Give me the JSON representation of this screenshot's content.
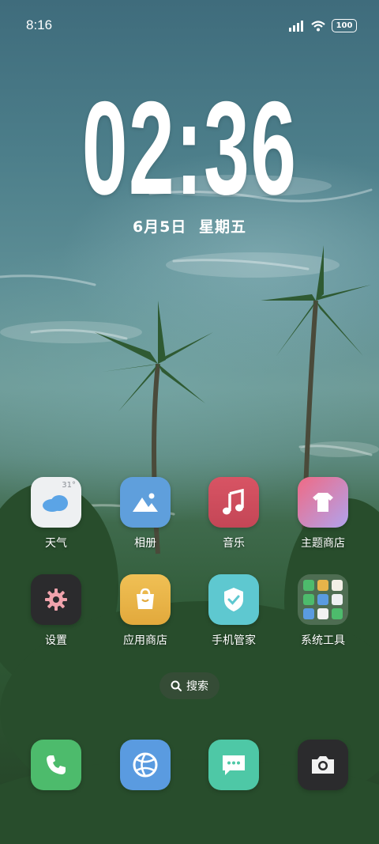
{
  "status_bar": {
    "time": "8:16",
    "battery": "100"
  },
  "lockclock": {
    "time": "02:36",
    "date_day": "6月5日",
    "date_weekday": "星期五"
  },
  "apps": [
    {
      "label": "天气",
      "icon": "weather-icon",
      "temp": "31°"
    },
    {
      "label": "相册",
      "icon": "gallery-icon"
    },
    {
      "label": "音乐",
      "icon": "music-icon"
    },
    {
      "label": "主题商店",
      "icon": "theme-store-icon"
    },
    {
      "label": "设置",
      "icon": "settings-icon"
    },
    {
      "label": "应用商店",
      "icon": "app-store-icon"
    },
    {
      "label": "手机管家",
      "icon": "security-icon"
    },
    {
      "label": "系统工具",
      "icon": "folder-icon"
    }
  ],
  "search": {
    "label": "搜索"
  },
  "dock": [
    {
      "icon": "phone-icon"
    },
    {
      "icon": "browser-icon"
    },
    {
      "icon": "messages-icon"
    },
    {
      "icon": "camera-icon"
    }
  ],
  "colors": {
    "weather": "#eef0f2",
    "gallery": "#5f9fdc",
    "music": "#d4505f",
    "theme": "#e8708a",
    "settings": "#2b2b2d",
    "app_store": "#e7b44a",
    "security": "#5ec8d0",
    "phone": "#4dbb6c",
    "browser": "#5a9be0",
    "messages": "#4ec8a6",
    "camera": "#2b2b2d"
  }
}
